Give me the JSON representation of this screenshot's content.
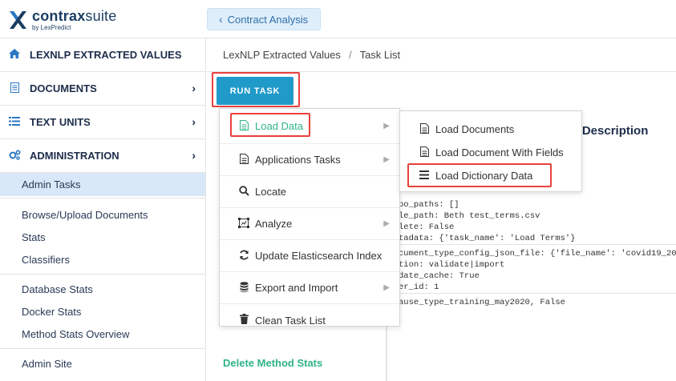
{
  "brand": {
    "name_bold": "contrax",
    "name_light": "suite",
    "by": "by LexPredict"
  },
  "header": {
    "back_label": "Contract Analysis"
  },
  "sidebar": {
    "sections": [
      {
        "label": "LEXNLP EXTRACTED VALUES",
        "icon": "home-icon"
      },
      {
        "label": "DOCUMENTS",
        "icon": "document-icon"
      },
      {
        "label": "TEXT UNITS",
        "icon": "list-icon"
      },
      {
        "label": "ADMINISTRATION",
        "icon": "gears-icon"
      }
    ],
    "admin_items": [
      "Admin Tasks",
      "Browse/Upload Documents",
      "Stats",
      "Classifiers",
      "Database Stats",
      "Docker Stats",
      "Method Stats Overview",
      "Admin Site"
    ]
  },
  "breadcrumb": {
    "parent": "LexNLP Extracted Values",
    "current": "Task List"
  },
  "run_task": {
    "label": "RUN TASK"
  },
  "menu": {
    "items": [
      {
        "label": "Load Data",
        "icon": "file-icon"
      },
      {
        "label": "Applications Tasks",
        "icon": "file-icon"
      },
      {
        "label": "Locate",
        "icon": "search-icon"
      },
      {
        "label": "Analyze",
        "icon": "analyze-icon"
      },
      {
        "label": "Update Elasticsearch Index",
        "icon": "refresh-icon"
      },
      {
        "label": "Export and Import",
        "icon": "database-icon"
      },
      {
        "label": "Clean Task List",
        "icon": "trash-icon"
      }
    ]
  },
  "submenu": {
    "items": [
      {
        "label": "Load Documents",
        "icon": "file-icon"
      },
      {
        "label": "Load Document With Fields",
        "icon": "file-icon"
      },
      {
        "label": "Load Dictionary Data",
        "icon": "bars-icon"
      }
    ]
  },
  "table": {
    "header_partial": "ts / Description",
    "rows": [
      "po_paths: []\nle_path: Beth test_terms.csv\nlete: False\ntadata: {'task_name': 'Load Terms'}",
      "cument_type_config_json_file: {'file_name': 'covid19_20\ntion: validate|import\ndate_cache: True\ner_id: 1",
      "ause_type_training_may2020, False"
    ],
    "delete_link": "Delete Method Stats"
  },
  "colors": {
    "accent": "#1f9ac9",
    "highlight": "#e8413d",
    "green": "#2fb38a",
    "navy": "#1c2d4a"
  }
}
